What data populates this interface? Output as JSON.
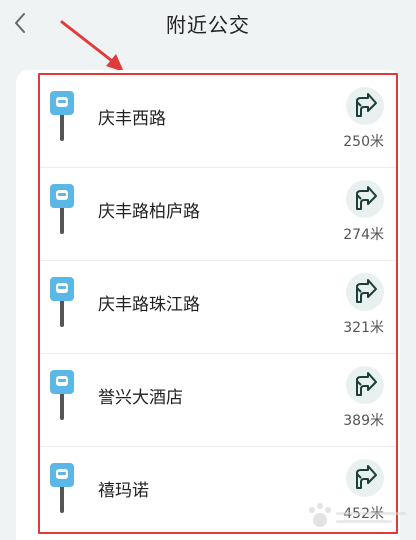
{
  "header": {
    "title": "附近公交"
  },
  "stops": [
    {
      "name": "庆丰西路",
      "distance": "250米"
    },
    {
      "name": "庆丰路柏庐路",
      "distance": "274米"
    },
    {
      "name": "庆丰路珠江路",
      "distance": "321米"
    },
    {
      "name": "誉兴大酒店",
      "distance": "389米"
    },
    {
      "name": "禧玛诺",
      "distance": "452米"
    }
  ],
  "icons": {
    "back": "chevron-left-icon",
    "stop": "bus-stop-sign-icon",
    "navigate": "turn-direction-icon"
  },
  "colors": {
    "background": "#eff3f3",
    "card": "#ffffff",
    "highlight": "#e23a3a",
    "stop_icon": "#5bb8e6",
    "nav_icon": "#1d3d38"
  }
}
